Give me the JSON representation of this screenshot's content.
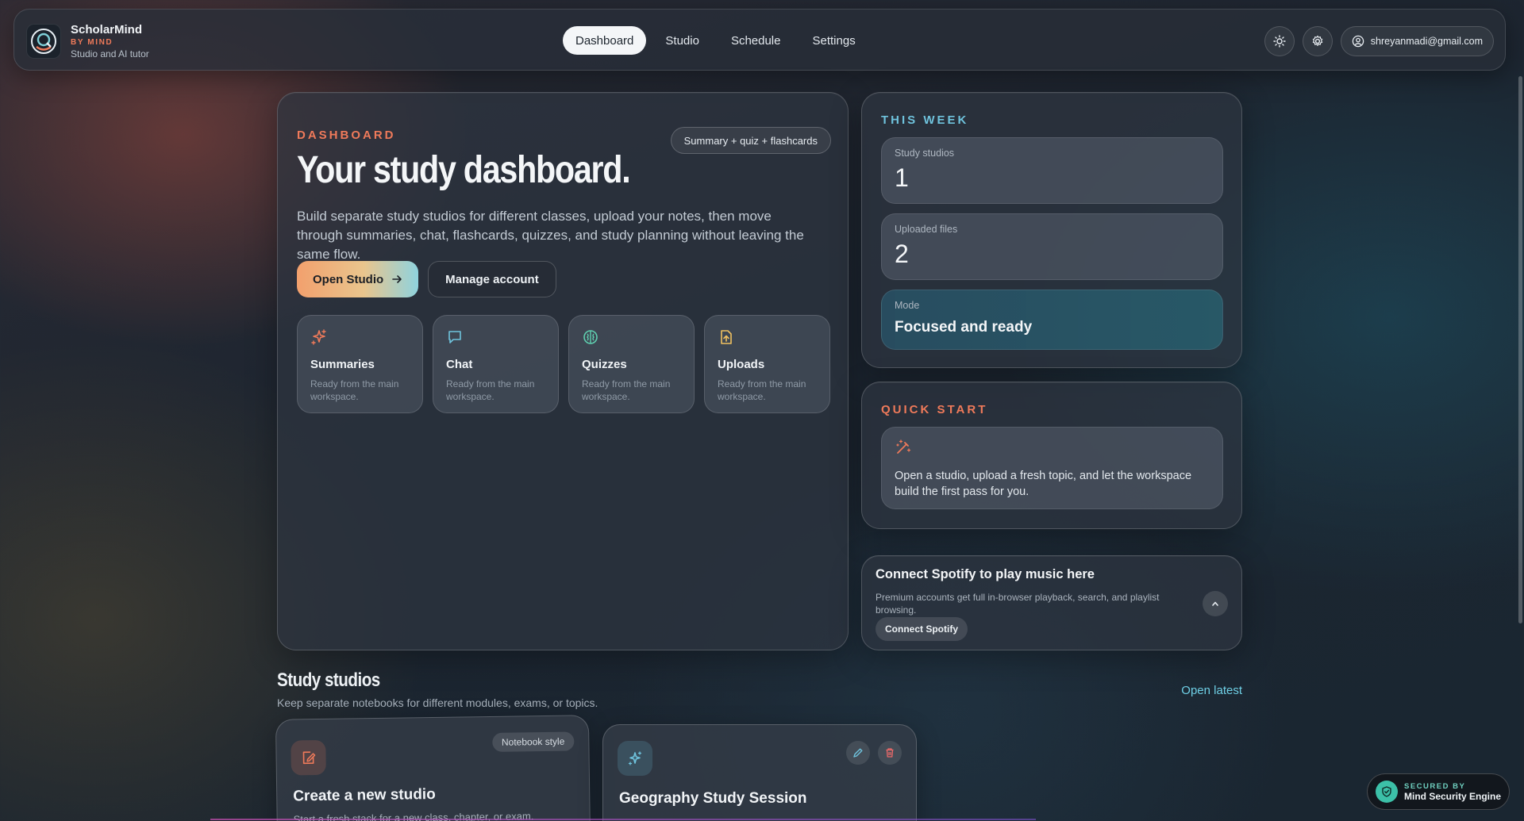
{
  "brand": {
    "name": "ScholarMind",
    "by": "BY MIND",
    "tagline": "Studio and AI tutor"
  },
  "nav": {
    "items": [
      {
        "label": "Dashboard",
        "active": true
      },
      {
        "label": "Studio",
        "active": false
      },
      {
        "label": "Schedule",
        "active": false
      },
      {
        "label": "Settings",
        "active": false
      }
    ]
  },
  "header_actions": {
    "theme_icon": "sun-icon",
    "settings_icon": "gear-icon",
    "account_email": "shreyanmadi@gmail.com"
  },
  "dashboard": {
    "eyebrow": "DASHBOARD",
    "chip": "Summary + quiz + flashcards",
    "title": "Your study dashboard.",
    "intro": "Build separate study studios for different classes, upload your notes, then move through summaries, chat, flashcards, quizzes, and study planning without leaving the same flow.",
    "primary_cta": "Open Studio",
    "secondary_cta": "Manage account",
    "features": [
      {
        "title": "Summaries",
        "desc": "Ready from the main workspace.",
        "icon": "sparkle-icon",
        "color": "#ef7a5a"
      },
      {
        "title": "Chat",
        "desc": "Ready from the main workspace.",
        "icon": "chat-icon",
        "color": "#6fc3dd"
      },
      {
        "title": "Quizzes",
        "desc": "Ready from the main workspace.",
        "icon": "brain-icon",
        "color": "#5fd0b0"
      },
      {
        "title": "Uploads",
        "desc": "Ready from the main workspace.",
        "icon": "file-upload-icon",
        "color": "#f0c060"
      }
    ]
  },
  "this_week": {
    "eyebrow": "THIS WEEK",
    "stats": [
      {
        "label": "Study studios",
        "value": "1"
      },
      {
        "label": "Uploaded files",
        "value": "2"
      },
      {
        "label": "Mode",
        "value": "Focused and ready"
      }
    ]
  },
  "quick_start": {
    "eyebrow": "QUICK START",
    "text": "Open a studio, upload a fresh topic, and let the workspace build the first pass for you."
  },
  "spotify": {
    "title": "Connect Spotify to play music here",
    "desc": "Premium accounts get full in-browser playback, search, and playlist browsing.",
    "button": "Connect Spotify"
  },
  "studios": {
    "title": "Study studios",
    "subtitle": "Keep separate notebooks for different modules, exams, or topics.",
    "open_latest": "Open latest",
    "new_card": {
      "chip": "Notebook style",
      "title": "Create a new studio",
      "desc": "Start a fresh stack for a new class, chapter, or exam."
    },
    "cards": [
      {
        "title": "Geography Study Session"
      }
    ]
  },
  "secured": {
    "top": "SECURED BY",
    "bottom": "Mind Security Engine"
  },
  "colors": {
    "accent_orange": "#ef7a5a",
    "accent_teal": "#6fc3dd"
  }
}
